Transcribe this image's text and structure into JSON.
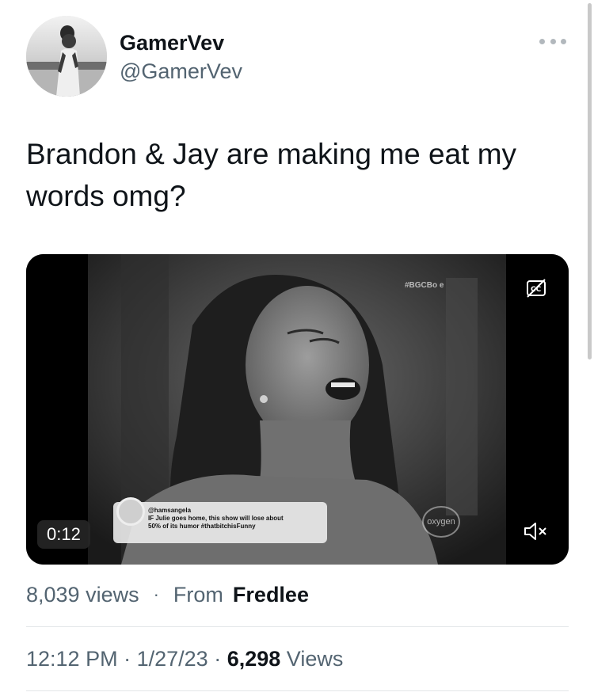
{
  "tweet": {
    "display_name": "GamerVev",
    "handle": "@GamerVev",
    "text": "Brandon & Jay are making me eat my words omg?",
    "video": {
      "duration": "0:12",
      "overlay_hashtag": "#BGCBo   e",
      "ticker_user": "@hamsangela",
      "ticker_line1": "IF Julie goes home, this show will lose about",
      "ticker_line2": "50% of its humor #thatbitchisFunny",
      "network_logo": "oxygen"
    },
    "views_count_text": "8,039 views",
    "separator": "·",
    "from_label": "From",
    "source_name": "Fredlee",
    "time": "12:12 PM",
    "date": "1/27/23",
    "view_total": "6,298",
    "views_label": "Views"
  },
  "icons": {
    "more": "more-dots-icon",
    "captions": "closed-captions-icon",
    "mute": "speaker-muted-icon",
    "twitter": "twitter-bird-icon"
  },
  "colors": {
    "text_primary": "#0f1419",
    "text_secondary": "#536471",
    "divider": "#e3e6e8"
  }
}
